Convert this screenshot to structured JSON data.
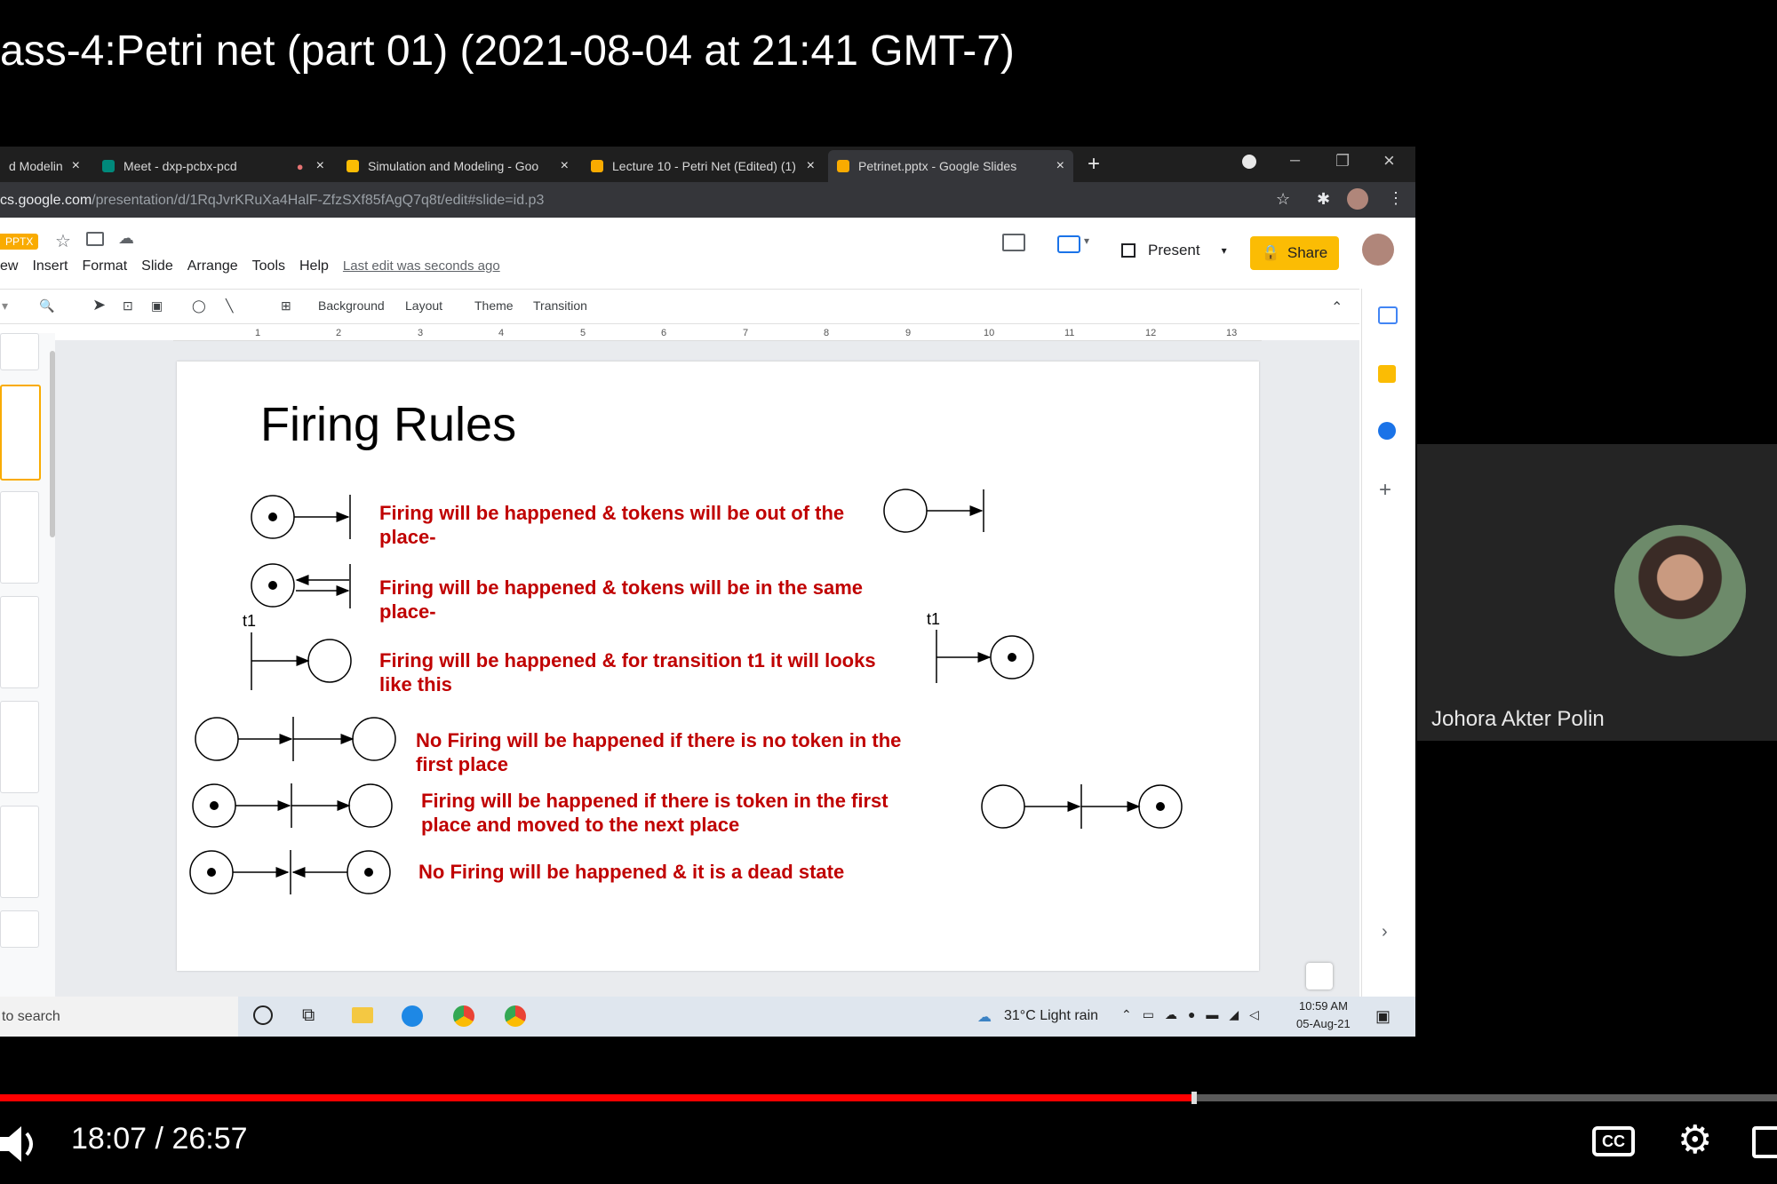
{
  "video": {
    "title": "ass-4:Petri net (part 01) (2021-08-04 at 21:41 GMT-7)",
    "current_time": "18:07",
    "separator": "/",
    "duration": "26:57",
    "progress_fraction": 0.672
  },
  "browser": {
    "tabs": [
      {
        "label": "d Modelin",
        "color": "#4285f4"
      },
      {
        "label": "Meet - dxp-pcbx-pcd",
        "color": "#00897b"
      },
      {
        "label": "Simulation and Modeling - Goo",
        "color": "#fbbc04"
      },
      {
        "label": "Lecture 10 - Petri Net (Edited) (1)",
        "color": "#f9ab00"
      },
      {
        "label": "Petrinet.pptx - Google Slides",
        "color": "#f9ab00"
      }
    ],
    "url_host": "cs.google.com",
    "url_path": "/presentation/d/1RqJvrKRuXa4HalF-ZfzSXf85fAgQ7q8t/edit#slide=id.p3"
  },
  "slides_app": {
    "file_badge": "PPTX",
    "menu": [
      "ew",
      "Insert",
      "Format",
      "Slide",
      "Arrange",
      "Tools",
      "Help"
    ],
    "last_edit": "Last edit was seconds ago",
    "present_label": "Present",
    "share_label": "Share",
    "toolbar": [
      "Background",
      "Layout",
      "Theme",
      "Transition"
    ],
    "ruler_numbers": [
      "1",
      "2",
      "3",
      "4",
      "5",
      "6",
      "7",
      "8",
      "9",
      "10",
      "11",
      "12",
      "13"
    ]
  },
  "slide": {
    "title": "Firing Rules",
    "rules": [
      "Firing will be happened & tokens will be out of the\nplace-",
      "Firing will be happened & tokens will be in the same\nplace-",
      "Firing will be happened & for transition t1 it will looks\nlike this",
      "No Firing will be happened if there is no token in the\nfirst place",
      "Firing will be happened if there is token in the first\nplace and moved to the next place",
      "No Firing will be happened & it is a dead state"
    ],
    "t1_label": "t1"
  },
  "taskbar": {
    "search_text": "to search",
    "weather": "31°C  Light rain",
    "time": "10:59 AM",
    "date": "05-Aug-21"
  },
  "participant": {
    "name": "Johora Akter Polin"
  }
}
